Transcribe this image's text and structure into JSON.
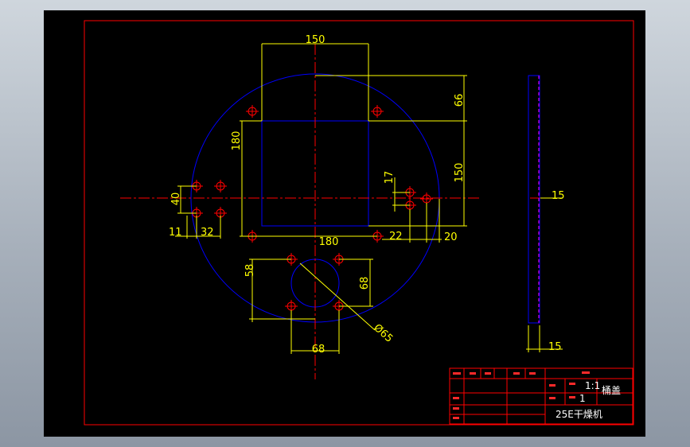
{
  "drawing": {
    "dimensions": {
      "top_width": "150",
      "top_offset": "66",
      "right_height": "150",
      "left_height": "180",
      "bottom_width": "180",
      "left_spacing": "40",
      "left_offset": "11",
      "left_hole_pitch": "32",
      "small_offset": "17",
      "right_offset_a": "22",
      "right_offset_b": "20",
      "hole_box_height": "58",
      "hole_box_inner": "68",
      "hole_box_width": "68",
      "hole_diameter": "Ø65",
      "side_thickness": "15",
      "side_bottom": "15"
    },
    "title_block": {
      "part_name": "桶盖",
      "quantity": "1",
      "scale": "1:1",
      "drawing_title": "25E干燥机"
    },
    "colors": {
      "background": "#000000",
      "border": "#ff0000",
      "outline": "#0000ff",
      "dimension": "#ffff00",
      "centerline": "#ff0000",
      "hidden": "#ff00ff",
      "text": "#ffffff"
    }
  }
}
